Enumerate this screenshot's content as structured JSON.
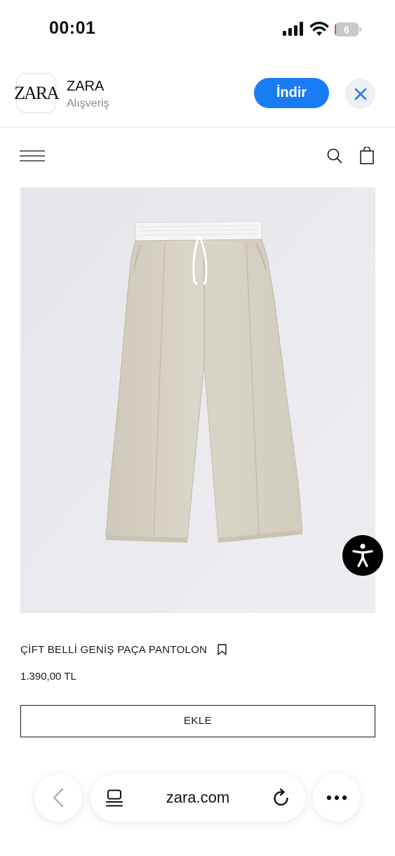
{
  "status_bar": {
    "time": "00:01",
    "battery_level": "6",
    "battery_fraction": 0.06,
    "battery_color": "#e5484d"
  },
  "app_banner": {
    "name": "ZARA",
    "category": "Alışveriş",
    "logo_text": "ZARA",
    "get_label": "İndir",
    "accent_color": "#1a7cf5"
  },
  "header": {
    "icons": [
      "menu-icon",
      "search-icon",
      "shopping-bag-icon"
    ]
  },
  "product": {
    "name": "ÇİFT BELLİ GENİŞ PAÇA PANTOLON",
    "price": "1.390,00 TL",
    "add_label": "EKLE",
    "image_description_icon": "wide-leg-trousers-image"
  },
  "browser": {
    "address": "zara.com",
    "icons": [
      "back-icon",
      "tabs-icon",
      "reload-icon",
      "more-icon"
    ]
  }
}
